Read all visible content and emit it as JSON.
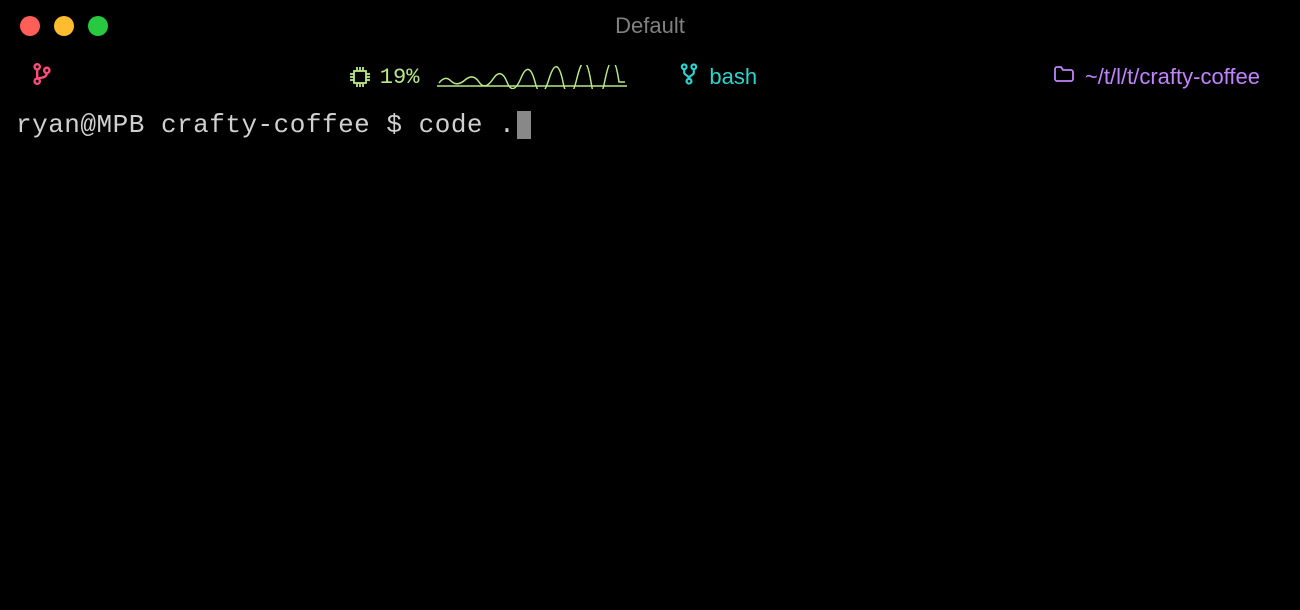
{
  "window": {
    "title": "Default"
  },
  "statusbar": {
    "cpu_percent": "19%",
    "shell_name": "bash",
    "cwd": "~/t/l/t/crafty-coffee"
  },
  "prompt": {
    "user_host": "ryan@MPB",
    "directory": "crafty-coffee",
    "symbol": "$",
    "command": "code ."
  },
  "colors": {
    "close": "#ff5f57",
    "minimize": "#febc2e",
    "maximize": "#28c840",
    "git": "#ff4d7a",
    "cpu": "#b8e986",
    "shell": "#2dd4cf",
    "cwd": "#c084fc"
  }
}
